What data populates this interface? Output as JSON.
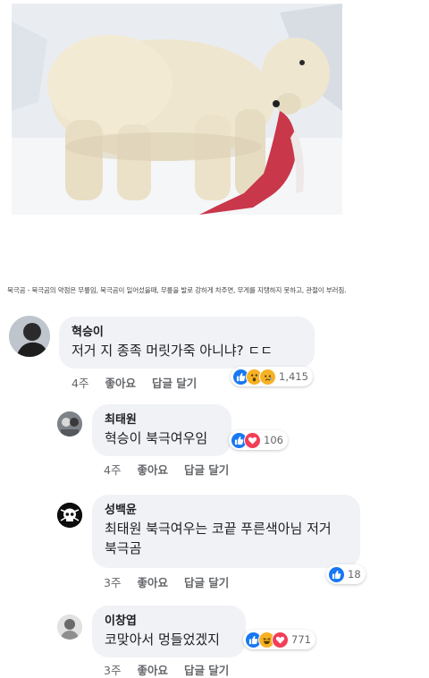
{
  "caption": "북극곰 - 북극곰의 약점은 무릎임, 북극곰이 일어섰을때, 무릎을 발로 강하게 차주면, 무게를 지탱하지 못하고, 관절이 부러짐.",
  "colors": {
    "bubble": "#f0f2f5",
    "like": "#1877f2",
    "love": "#f33e58",
    "haha": "#f7b125",
    "meta": "#65676b"
  },
  "comments": [
    {
      "name": "혁승이",
      "text": "저거 지 종족 머릿가죽 아니냐? ㄷㄷ",
      "time": "4주",
      "like_label": "좋아요",
      "reply_label": "답글 달기",
      "reactions": [
        "like-icon",
        "wow-icon",
        "sad-icon"
      ],
      "count": "1,415"
    },
    {
      "name": "최태원",
      "text": "혁승이 북극여우임",
      "time": "4주",
      "like_label": "좋아요",
      "reply_label": "답글 달기",
      "reactions": [
        "like-icon",
        "love-icon"
      ],
      "count": "106"
    },
    {
      "name": "성백윤",
      "text": "최태원 북극여우는 코끝 푸른색아님 저거 북극곰",
      "time": "3주",
      "like_label": "좋아요",
      "reply_label": "답글 달기",
      "reactions": [
        "like-icon"
      ],
      "count": "18"
    },
    {
      "name": "이창엽",
      "text": "코맞아서 멍들었겠지",
      "time": "3주",
      "like_label": "좋아요",
      "reply_label": "답글 달기",
      "reactions": [
        "like-icon",
        "haha-icon",
        "love-icon"
      ],
      "count": "771"
    }
  ]
}
